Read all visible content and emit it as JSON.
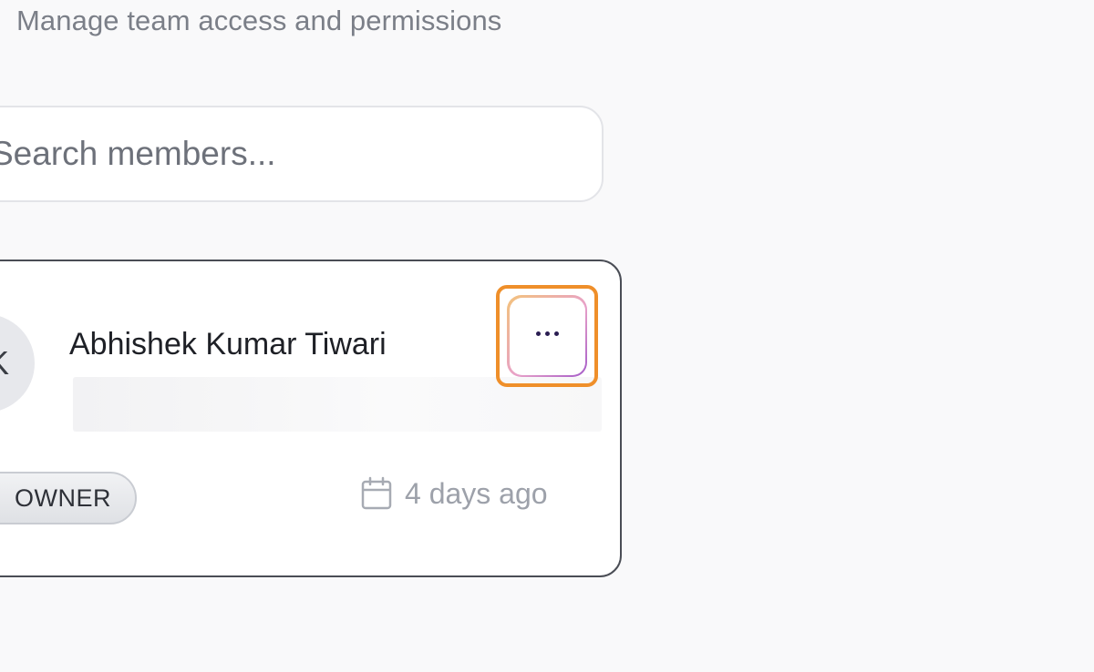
{
  "header": {
    "subtitle": "Manage team access and permissions"
  },
  "search": {
    "placeholder": "Search members..."
  },
  "member": {
    "avatar_initials": "AK",
    "name": "Abhishek Kumar Tiwari",
    "more_icon": "more-horizontal-icon",
    "role": "OWNER",
    "calendar_icon": "calendar-icon",
    "joined": "4 days ago"
  },
  "colors": {
    "highlight": "#ef8f2a",
    "more_button_gradient": [
      "#f3c37b",
      "#e8a1c8",
      "#a45bc9"
    ],
    "dots": "#2a1d52",
    "card_border": "#4a4d55"
  }
}
